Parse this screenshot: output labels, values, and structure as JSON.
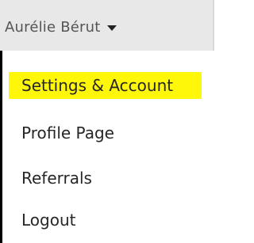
{
  "header": {
    "user_name": "Aurélie Bérut",
    "caret_icon": "caret-down-icon"
  },
  "menu": {
    "items": [
      {
        "label": "Settings & Account",
        "highlighted": true,
        "highlight_color": "#fff70a"
      },
      {
        "label": "Profile Page"
      },
      {
        "label": "Referrals"
      },
      {
        "label": "Logout"
      }
    ]
  }
}
